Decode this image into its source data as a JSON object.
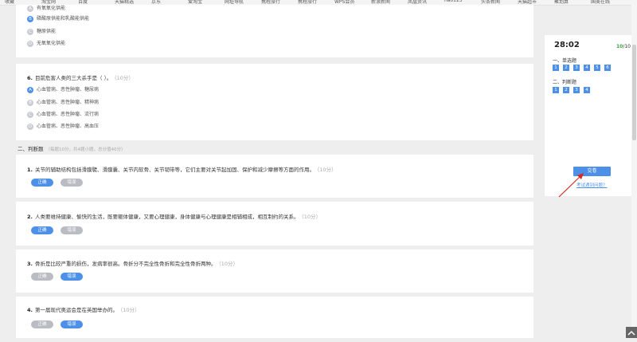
{
  "bookmarks": [
    "收藏",
    "淘宝网",
    "百度",
    "天猫精选",
    "京东",
    "爱淘宝",
    "网址导航",
    "携程旅行",
    "携程旅行",
    "WPS会员",
    "新浪新闻",
    "凤凰资讯",
    "hao123",
    "头条新闻",
    "天猫超市",
    "聚划算",
    "国美在线"
  ],
  "q5": {
    "options": [
      {
        "letter": "A",
        "text": "有氧氧化供能",
        "selected": false
      },
      {
        "letter": "B",
        "text": "磷酸原供能和乳酸能供能",
        "selected": true
      },
      {
        "letter": "C",
        "text": "糖原供能",
        "selected": false
      },
      {
        "letter": "D",
        "text": "无氧氧化供能",
        "selected": false
      }
    ]
  },
  "q6": {
    "num": "6.",
    "text": "目前危害人类的三大杀手是（ ）。",
    "score": "（10分）",
    "options": [
      {
        "letter": "A",
        "text": "心血管病、恶性肿瘤、糖尿病",
        "selected": true
      },
      {
        "letter": "B",
        "text": "心血管病、恶性肿瘤、精神病",
        "selected": false
      },
      {
        "letter": "C",
        "text": "心血管病、恶性肿瘤、流行病",
        "selected": false
      },
      {
        "letter": "D",
        "text": "心血管病、恶性肿瘤、高血压",
        "selected": false
      }
    ]
  },
  "section2": {
    "title": "二、判断题",
    "meta": "（每题10分，共4题小题，总分值40分）"
  },
  "tf_questions": [
    {
      "num": "1.",
      "text": "关节的辅助结构包括滑膜襞、滑膜囊、关节内软骨、关节韧带等，它们主要对关节起加固、保护和减少摩擦等方面的作用。",
      "score": "（10分）",
      "true_label": "正确",
      "false_label": "错误",
      "answer": "true"
    },
    {
      "num": "2.",
      "text": "人类要维持健康、愉快的生活，既要躯体健康，又要心理健康，身体健康与心理健康是相辅相成，相互制约的关系。",
      "score": "（10分）",
      "true_label": "正确",
      "false_label": "错误",
      "answer": "true"
    },
    {
      "num": "3.",
      "text": "骨折是比较严重的损伤，发病率很高。骨折分不完全性骨折和完全性骨折两种。",
      "score": "（10分）",
      "true_label": "正确",
      "false_label": "错误",
      "answer": "false"
    },
    {
      "num": "4.",
      "text": "第一届现代奥运会是在英国举办的。",
      "score": "（10分）",
      "true_label": "正确",
      "false_label": "错误",
      "answer": "false"
    }
  ],
  "panel": {
    "timer": "28:02",
    "answered": "10",
    "separator": "/",
    "total": "10",
    "group1": {
      "label": "一、单选题",
      "numbers": [
        "1",
        "2",
        "3",
        "4",
        "5",
        "6"
      ]
    },
    "group2": {
      "label": "二、判断题",
      "numbers": [
        "1",
        "2",
        "3",
        "4"
      ]
    },
    "submit_label": "交卷",
    "report_label": "考试遇到问题？"
  },
  "colors": {
    "accent": "#4d90e8",
    "muted": "#b9bcc2",
    "done": "#3aa33a"
  },
  "icons": [
    "back-to-top-icon",
    "arrow-annotation-icon"
  ]
}
